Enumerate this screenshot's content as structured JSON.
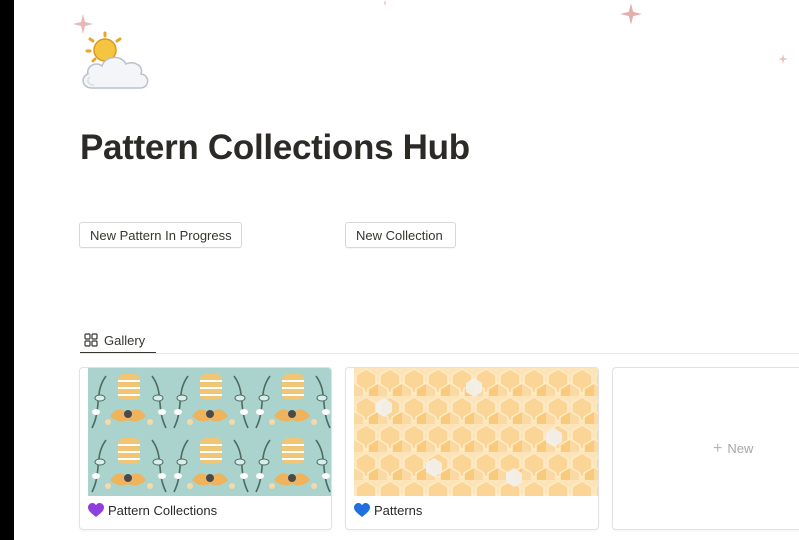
{
  "page": {
    "title": "Pattern Collections Hub",
    "icon": "sun-behind-cloud-icon"
  },
  "buttons": [
    {
      "label": "New Pattern In Progress"
    },
    {
      "label": "New Collection"
    }
  ],
  "views": [
    {
      "label": "Gallery",
      "icon": "gallery-grid-icon",
      "active": true
    }
  ],
  "gallery": {
    "cards": [
      {
        "title": "Pattern Collections",
        "emoji": "purple-heart-icon"
      },
      {
        "title": "Patterns",
        "emoji": "blue-heart-icon"
      }
    ],
    "new_label": "New"
  },
  "colors": {
    "title": "#2b2a26",
    "purple_heart": "#8f3ee0",
    "blue_heart": "#1f6fe0",
    "floral_bg": "#a9d3cc",
    "honeycomb_bg": "#fde4b8"
  }
}
